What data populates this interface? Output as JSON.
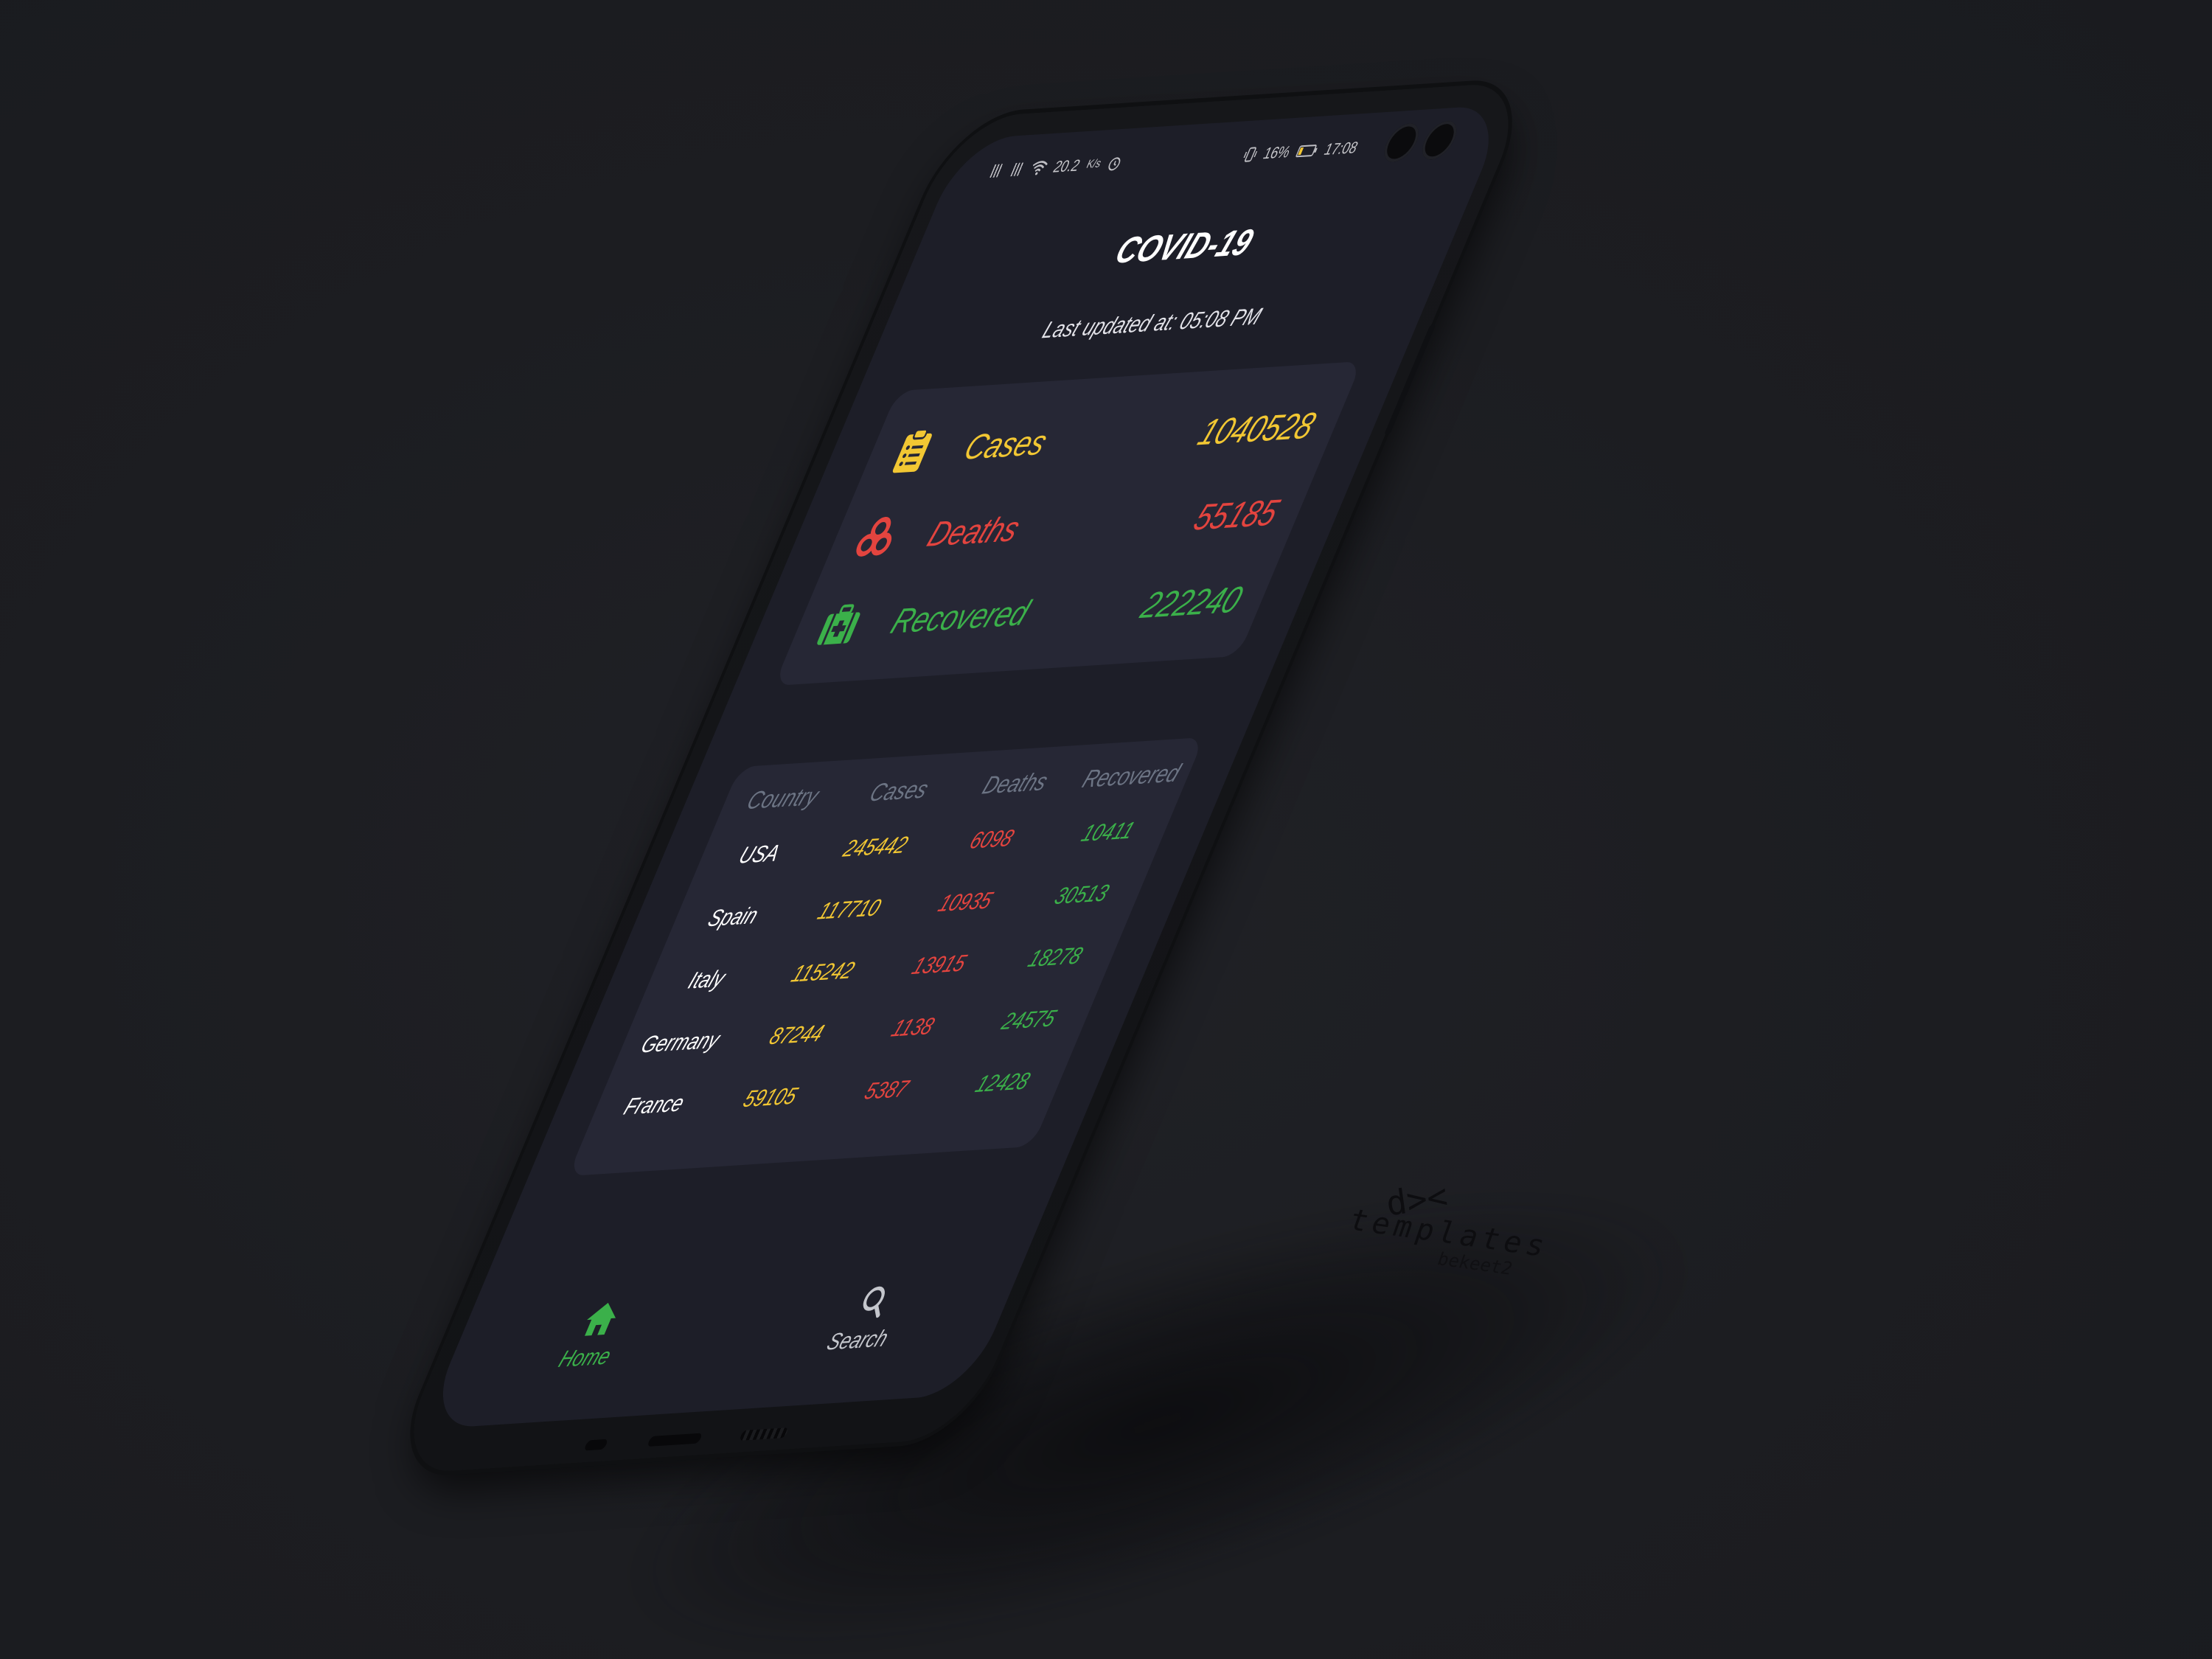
{
  "status_bar": {
    "network_speed": "20.2",
    "network_unit": "K/s",
    "battery": "16%",
    "time": "17:08"
  },
  "header": {
    "title": "COVID-19",
    "last_updated": "Last updated at: 05:08 PM"
  },
  "summary": [
    {
      "label": "Cases",
      "value": "1040528",
      "icon": "clipboard-list-icon",
      "color": "#f2c733"
    },
    {
      "label": "Deaths",
      "value": "55185",
      "icon": "biohazard-icon",
      "color": "#e3443f"
    },
    {
      "label": "Recovered",
      "value": "222240",
      "icon": "medical-kit-icon",
      "color": "#3bb04a"
    }
  ],
  "table": {
    "headers": [
      "Country",
      "Cases",
      "Deaths",
      "Recovered"
    ],
    "rows": [
      {
        "country": "USA",
        "cases": "245442",
        "deaths": "6098",
        "recovered": "10411"
      },
      {
        "country": "Spain",
        "cases": "117710",
        "deaths": "10935",
        "recovered": "30513"
      },
      {
        "country": "Italy",
        "cases": "115242",
        "deaths": "13915",
        "recovered": "18278"
      },
      {
        "country": "Germany",
        "cases": "87244",
        "deaths": "1138",
        "recovered": "24575"
      },
      {
        "country": "France",
        "cases": "59105",
        "deaths": "5387",
        "recovered": "12428"
      }
    ]
  },
  "bottom_nav": {
    "home_label": "Home",
    "search_label": "Search",
    "active": "home"
  },
  "colors": {
    "background": "#1c1d21",
    "screen": "#1d1e28",
    "card": "#262735",
    "cases": "#f2c733",
    "deaths": "#e3443f",
    "recovered": "#3bb04a",
    "header_text": "#6c7484"
  },
  "watermark": {
    "logo": "d><",
    "text": "templates",
    "subtext": "bekeet2"
  }
}
